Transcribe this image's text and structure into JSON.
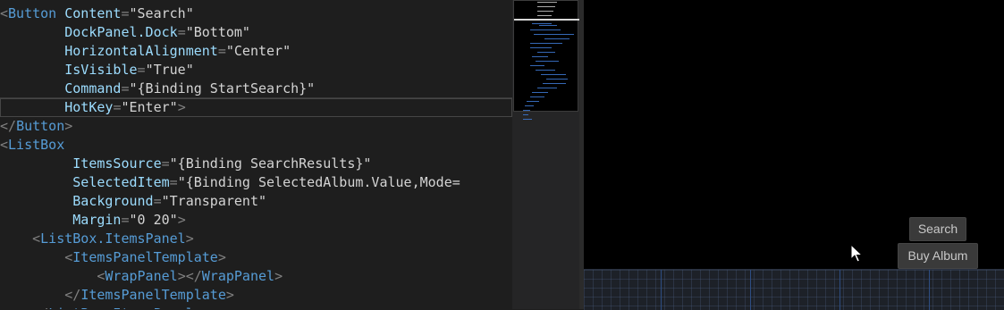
{
  "editor": {
    "lines": [
      [
        [
          "<",
          "punct"
        ],
        [
          "Button",
          "tag"
        ],
        [
          " Content",
          "attr"
        ],
        [
          "=",
          "punct"
        ],
        [
          "\"Search\"",
          "str"
        ]
      ],
      [
        [
          "        DockPanel.Dock",
          "attr"
        ],
        [
          "=",
          "punct"
        ],
        [
          "\"Bottom\"",
          "str"
        ]
      ],
      [
        [
          "        HorizontalAlignment",
          "attr"
        ],
        [
          "=",
          "punct"
        ],
        [
          "\"Center\"",
          "str"
        ]
      ],
      [
        [
          "        IsVisible",
          "attr"
        ],
        [
          "=",
          "punct"
        ],
        [
          "\"True\"",
          "str"
        ]
      ],
      [
        [
          "        Command",
          "attr"
        ],
        [
          "=",
          "punct"
        ],
        [
          "\"{Binding StartSearch}\"",
          "str"
        ]
      ],
      [
        [
          "        HotKey",
          "attr"
        ],
        [
          "=",
          "punct"
        ],
        [
          "\"Enter\"",
          "str"
        ],
        [
          ">",
          "punct"
        ]
      ],
      [
        [
          "</",
          "punct"
        ],
        [
          "Button",
          "tag"
        ],
        [
          ">",
          "punct"
        ]
      ],
      [
        [
          "<",
          "punct"
        ],
        [
          "ListBox",
          "tag"
        ]
      ],
      [
        [
          "         ItemsSource",
          "attr"
        ],
        [
          "=",
          "punct"
        ],
        [
          "\"{Binding SearchResults}\"",
          "str"
        ]
      ],
      [
        [
          "         SelectedItem",
          "attr"
        ],
        [
          "=",
          "punct"
        ],
        [
          "\"{Binding SelectedAlbum.Value,Mode=",
          "str"
        ]
      ],
      [
        [
          "         Background",
          "attr"
        ],
        [
          "=",
          "punct"
        ],
        [
          "\"Transparent\"",
          "str"
        ]
      ],
      [
        [
          "         Margin",
          "attr"
        ],
        [
          "=",
          "punct"
        ],
        [
          "\"0 20\"",
          "str"
        ],
        [
          ">",
          "punct"
        ]
      ],
      [
        [
          "    <",
          "punct"
        ],
        [
          "ListBox.ItemsPanel",
          "tag"
        ],
        [
          ">",
          "punct"
        ]
      ],
      [
        [
          "        <",
          "punct"
        ],
        [
          "ItemsPanelTemplate",
          "tag"
        ],
        [
          ">",
          "punct"
        ]
      ],
      [
        [
          "            <",
          "punct"
        ],
        [
          "WrapPanel",
          "tag"
        ],
        [
          "></",
          "punct"
        ],
        [
          "WrapPanel",
          "tag"
        ],
        [
          ">",
          "punct"
        ]
      ],
      [
        [
          "        </",
          "punct"
        ],
        [
          "ItemsPanelTemplate",
          "tag"
        ],
        [
          ">",
          "punct"
        ]
      ],
      [
        [
          "    </",
          "punct"
        ],
        [
          "ListBox.ItemsPanel",
          "tag"
        ],
        [
          ">",
          "punct"
        ]
      ]
    ]
  },
  "preview": {
    "search_button": "Search",
    "buy_album_button": "Buy Album"
  },
  "colors": {
    "tag": "#569cd6",
    "attribute": "#9cdcfe",
    "string": "#d4d4d4",
    "punctuation": "#808080",
    "editor_background": "#1e1e1e",
    "preview_background": "#000000"
  }
}
